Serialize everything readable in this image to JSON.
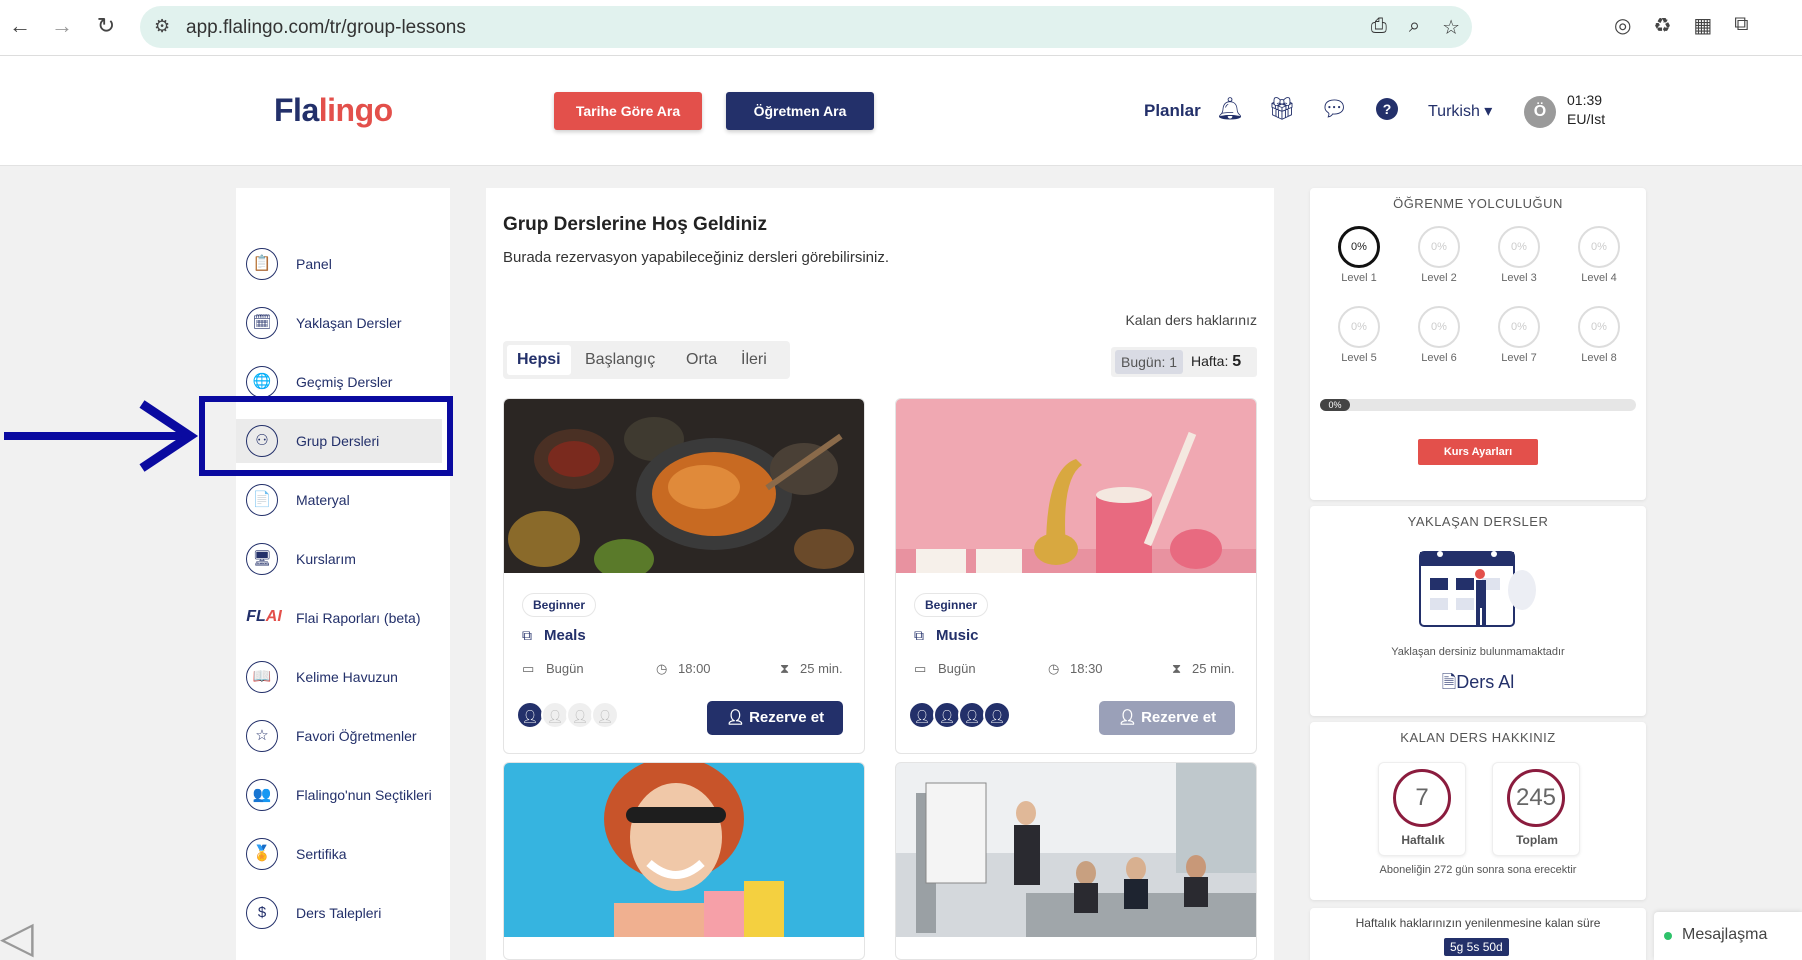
{
  "browser": {
    "url": "app.flalingo.com/tr/group-lessons"
  },
  "header": {
    "logo_part1": "Fla",
    "logo_part2": "lingo",
    "search_by_date": "Tarihe Göre Ara",
    "search_teacher": "Öğretmen Ara",
    "plans": "Planlar",
    "language": "Turkish",
    "avatar_letter": "Ö",
    "time": "01:39",
    "timezone": "EU/Ist"
  },
  "sidebar": {
    "items": [
      {
        "label": "Panel",
        "icon": "📋"
      },
      {
        "label": "Yaklaşan Dersler",
        "icon": "🗓"
      },
      {
        "label": "Geçmiş Dersler",
        "icon": "🌐"
      },
      {
        "label": "Grup Dersleri",
        "icon": "⚇"
      },
      {
        "label": "Materyal",
        "icon": "📄"
      },
      {
        "label": "Kurslarım",
        "icon": "🖥"
      },
      {
        "label": "Flai Raporları (beta)",
        "icon": "FLAI"
      },
      {
        "label": "Kelime Havuzun",
        "icon": "📖"
      },
      {
        "label": "Favori Öğretmenler",
        "icon": "☆"
      },
      {
        "label": "Flalingo'nun Seçtikleri",
        "icon": "👥"
      },
      {
        "label": "Sertifika",
        "icon": "🏅"
      },
      {
        "label": "Ders Talepleri",
        "icon": "$"
      }
    ],
    "flai_logo_a": "FL",
    "flai_logo_b": "AI"
  },
  "main": {
    "title": "Grup Derslerine Hoş Geldiniz",
    "subtitle": "Burada rezervasyon yapabileceğiniz dersleri görebilirsiniz.",
    "remaining_label": "Kalan ders haklarınız",
    "tabs": [
      "Hepsi",
      "Başlangıç",
      "Orta",
      "İleri"
    ],
    "today_label": "Bugün: 1",
    "week_label": "Hafta:",
    "week_value": "5",
    "cards": [
      {
        "level": "Beginner",
        "title": "Meals",
        "day": "Bugün",
        "time": "18:00",
        "duration": "25 min.",
        "reserve": "Rezerve et",
        "seats_taken": 1,
        "seats_total": 4,
        "reserve_color": "#23306a"
      },
      {
        "level": "Beginner",
        "title": "Music",
        "day": "Bugün",
        "time": "18:30",
        "duration": "25 min.",
        "reserve": "Rezerve et",
        "seats_taken": 4,
        "seats_total": 4,
        "reserve_color": "#9aa0b8"
      }
    ]
  },
  "journey": {
    "title": "ÖĞRENME YOLCULUĞUN",
    "levels": [
      {
        "name": "Level 1",
        "pct": "0%"
      },
      {
        "name": "Level 2",
        "pct": "0%"
      },
      {
        "name": "Level 3",
        "pct": "0%"
      },
      {
        "name": "Level 4",
        "pct": "0%"
      },
      {
        "name": "Level 5",
        "pct": "0%"
      },
      {
        "name": "Level 6",
        "pct": "0%"
      },
      {
        "name": "Level 7",
        "pct": "0%"
      },
      {
        "name": "Level 8",
        "pct": "0%"
      }
    ],
    "progress": "0%",
    "course_settings": "Kurs Ayarları"
  },
  "upcoming": {
    "title": "YAKLAŞAN DERSLER",
    "empty_text": "Yaklaşan dersiniz bulunmamaktadır",
    "take_lesson": "Ders Al"
  },
  "remaining": {
    "title": "KALAN DERS HAKKINIZ",
    "weekly_value": "7",
    "weekly_label": "Haftalık",
    "total_value": "245",
    "total_label": "Toplam",
    "note": "Aboneliğin 272 gün sonra sona erecektir"
  },
  "renewal": {
    "text": "Haftalık haklarınızın yenilenmesine kalan süre",
    "timer": "5g 5s 50d"
  },
  "messaging": {
    "label": "Mesajlaşma"
  },
  "colors": {
    "navy": "#23306a",
    "red": "#e3504b",
    "annotation": "#0a0aa0"
  }
}
